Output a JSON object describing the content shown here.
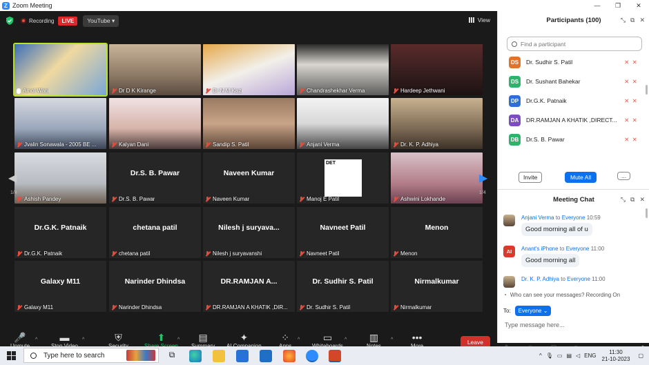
{
  "window": {
    "title": "Zoom Meeting"
  },
  "topbar": {
    "recording_label": "Recording",
    "live_badge": "LIVE",
    "stream_target": "YouTube",
    "view_label": "View"
  },
  "gallery": {
    "page_left": "1/4",
    "page_right": "1/4",
    "tiles": [
      {
        "name": "Amol Wani",
        "video": true,
        "muted": false,
        "active": true
      },
      {
        "name": "Dr D K Kirange",
        "video": true,
        "muted": true
      },
      {
        "name": "Dr N M Kazi",
        "video": true,
        "muted": true
      },
      {
        "name": "Chandrashekhar Verma",
        "video": true,
        "muted": true
      },
      {
        "name": "Hardeep Jethwani",
        "video": true,
        "muted": true
      },
      {
        "name": "Jvalin Sonawala - 2005 BE ...",
        "video": true,
        "muted": true
      },
      {
        "name": "Kalyan Dani",
        "video": true,
        "muted": true
      },
      {
        "name": "Sandip S. Patil",
        "video": true,
        "muted": true
      },
      {
        "name": "Anjani Verma",
        "video": true,
        "muted": true
      },
      {
        "name": "Dr. K. P. Adhiya",
        "video": true,
        "muted": true
      },
      {
        "name": "Ashish Pandey",
        "video": true,
        "muted": true
      },
      {
        "name": "Dr.S. B. Pawar",
        "big": "Dr.S. B. Pawar",
        "video": false,
        "muted": true
      },
      {
        "name": "Naveen Kumar",
        "big": "Naveen Kumar",
        "video": false,
        "muted": true
      },
      {
        "name": "Manoj E Patil",
        "video": true,
        "muted": true,
        "det": "DET"
      },
      {
        "name": "Ashwini Lokhande",
        "video": true,
        "muted": true
      },
      {
        "name": "Dr.G.K. Patnaik",
        "big": "Dr.G.K. Patnaik",
        "video": false,
        "muted": true
      },
      {
        "name": "chetana patil",
        "big": "chetana patil",
        "video": false,
        "muted": true
      },
      {
        "name": "Nilesh j suryavanshi",
        "big": "Nilesh j suryava...",
        "video": false,
        "muted": true
      },
      {
        "name": "Navneet Patil",
        "big": "Navneet Patil",
        "video": false,
        "muted": true
      },
      {
        "name": "Menon",
        "big": "Menon",
        "video": false,
        "muted": true
      },
      {
        "name": "Galaxy M11",
        "big": "Galaxy M11",
        "video": false,
        "muted": true
      },
      {
        "name": "Narinder Dhindsa",
        "big": "Narinder Dhindsa",
        "video": false,
        "muted": true
      },
      {
        "name": "DR.RAMJAN A KHATIK ,DIR...",
        "big": "DR.RAMJAN A...",
        "video": false,
        "muted": true
      },
      {
        "name": "Dr. Sudhir S. Patil",
        "big": "Dr. Sudhir S. Patil",
        "video": false,
        "muted": true
      },
      {
        "name": "Nirmalkumar",
        "big": "Nirmalkumar",
        "video": false,
        "muted": true
      }
    ]
  },
  "toolbar": {
    "items": [
      {
        "label": "Unmute",
        "icon": "mic-off-icon"
      },
      {
        "label": "Stop Video",
        "icon": "video-icon"
      },
      {
        "label": "Security",
        "icon": "shield-icon"
      },
      {
        "label": "Share Screen",
        "icon": "share-screen-icon"
      },
      {
        "label": "Summary",
        "icon": "summary-icon"
      },
      {
        "label": "AI Companion",
        "icon": "sparkle-icon"
      },
      {
        "label": "Apps",
        "icon": "apps-icon"
      },
      {
        "label": "Whiteboards",
        "icon": "whiteboard-icon"
      },
      {
        "label": "Notes",
        "icon": "notes-icon"
      },
      {
        "label": "More",
        "icon": "more-icon"
      }
    ],
    "leave_label": "Leave"
  },
  "participants": {
    "header": "Participants (100)",
    "search_placeholder": "Find a participant",
    "list": [
      {
        "initials": "DS",
        "name": "Dr. Sudhir S. Patil",
        "color": "#e0742e"
      },
      {
        "initials": "DS",
        "name": "Dr. Sushant Bahekar",
        "color": "#2fb36b"
      },
      {
        "initials": "DP",
        "name": "Dr.G.K. Patnaik",
        "color": "#2d6fd8"
      },
      {
        "initials": "DA",
        "name": "DR.RAMJAN A KHATIK ,DIRECT...",
        "color": "#7d4bc3"
      },
      {
        "initials": "DB",
        "name": "Dr.S. B. Pawar",
        "color": "#2fb36b"
      }
    ],
    "invite_label": "Invite",
    "mute_all_label": "Mute All",
    "more_label": "..."
  },
  "chat": {
    "header": "Meeting Chat",
    "messages": [
      {
        "from": "Anjani Verma",
        "to": "Everyone",
        "time": "10:59",
        "text": "Good morning  all of u",
        "avatar": "photo"
      },
      {
        "from": "Anant's iPhone",
        "to": "Everyone",
        "time": "11:00",
        "text": "Good morning all",
        "avatar": "AI",
        "avatar_color": "#d93a2b"
      },
      {
        "from": "Dr. K. P. Adhiya",
        "to": "Everyone",
        "time": "11:00",
        "text": "",
        "avatar": "photo"
      }
    ],
    "to_word": "to",
    "visibility_note": "Who can see your messages? Recording On",
    "to_label": "To:",
    "recipient": "Everyone",
    "input_placeholder": "Type message here..."
  },
  "taskbar": {
    "search_placeholder": "Type here to search",
    "time": "11:30",
    "date": "21-10-2023",
    "language": "ENG"
  }
}
